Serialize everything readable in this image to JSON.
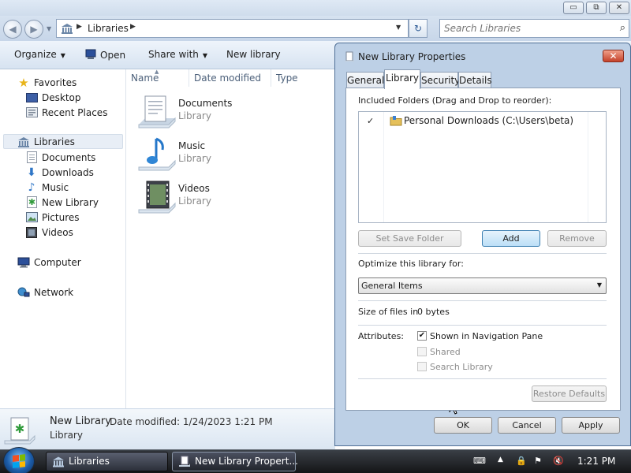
{
  "explorer": {
    "window_buttons": {
      "minimize": "▭",
      "maximize": "⧉",
      "close": "✕"
    },
    "address": {
      "crumb": "Libraries"
    },
    "search": {
      "placeholder": "Search Libraries"
    },
    "toolbar": {
      "organize": "Organize",
      "open": "Open",
      "share_with": "Share with",
      "new_library": "New library"
    },
    "nav": {
      "favorites": "Favorites",
      "desktop": "Desktop",
      "recent_places": "Recent Places",
      "libraries": "Libraries",
      "documents": "Documents",
      "downloads": "Downloads",
      "music": "Music",
      "new_library": "New Library",
      "pictures": "Pictures",
      "videos": "Videos",
      "computer": "Computer",
      "network": "Network"
    },
    "columns": {
      "name": "Name",
      "date_modified": "Date modified",
      "type": "Type"
    },
    "items": [
      {
        "name": "Documents",
        "type": "Library"
      },
      {
        "name": "Music",
        "type": "Library"
      },
      {
        "name": "Videos",
        "type": "Library"
      }
    ],
    "details": {
      "name": "New Library",
      "date_modified": "Date modified: 1/24/2023 1:21 PM",
      "type": "Library"
    }
  },
  "dialog": {
    "title": "New Library Properties",
    "close_glyph": "✕",
    "tabs": {
      "general": "General",
      "library": "Library",
      "security": "Security",
      "details": "Details"
    },
    "included_label": "Included Folders (Drag and Drop to reorder):",
    "folder": {
      "check": "✓",
      "path": "Personal Downloads (C:\\Users\\beta)"
    },
    "buttons": {
      "set_save_folder": "Set Save Folder",
      "add": "Add",
      "remove": "Remove",
      "restore_defaults": "Restore Defaults",
      "ok": "OK",
      "cancel": "Cancel",
      "apply": "Apply"
    },
    "optimize_label": "Optimize this library for:",
    "optimize_value": "General Items",
    "size_label": "Size of files in",
    "size_value": "0 bytes",
    "attributes_label": "Attributes:",
    "attributes": {
      "shown_in_nav": "Shown in Navigation Pane",
      "shown_in_nav_checked": true,
      "shared": "Shared",
      "search_library": "Search Library"
    }
  },
  "taskbar": {
    "tasks": {
      "libraries": "Libraries",
      "properties": "New Library Propert..."
    },
    "clock": "1:21 PM"
  }
}
